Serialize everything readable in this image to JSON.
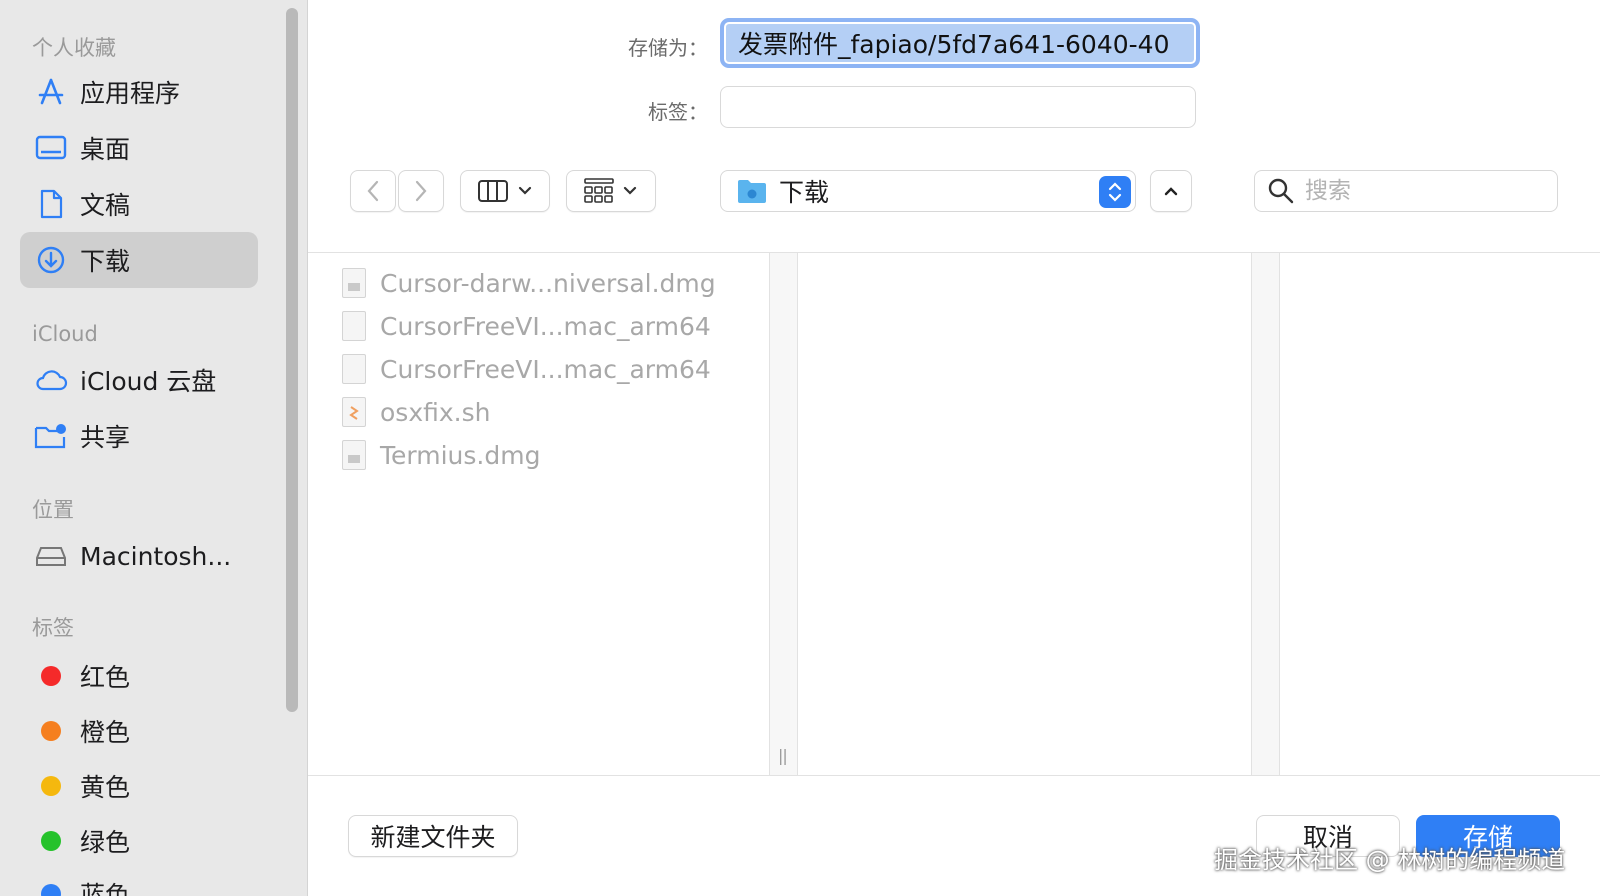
{
  "sidebar": {
    "sections": [
      {
        "title": "个人收藏"
      },
      {
        "title": "iCloud"
      },
      {
        "title": "位置"
      },
      {
        "title": "标签"
      }
    ],
    "favorites": [
      {
        "label": "应用程序",
        "icon": "applications-icon"
      },
      {
        "label": "桌面",
        "icon": "desktop-icon"
      },
      {
        "label": "文稿",
        "icon": "document-icon"
      },
      {
        "label": "下载",
        "icon": "downloads-icon",
        "selected": true
      }
    ],
    "icloud": [
      {
        "label": "iCloud 云盘",
        "icon": "icloud-icon"
      },
      {
        "label": "共享",
        "icon": "shared-folder-icon"
      }
    ],
    "locations": [
      {
        "label": "Macintosh...",
        "icon": "disk-icon"
      }
    ],
    "tags": [
      {
        "label": "红色",
        "color": "#f52a2a"
      },
      {
        "label": "橙色",
        "color": "#f57f1f"
      },
      {
        "label": "黄色",
        "color": "#f5b80e"
      },
      {
        "label": "绿色",
        "color": "#25c22b"
      },
      {
        "label": "蓝色",
        "color": "#2f7ff5"
      }
    ]
  },
  "form": {
    "save_as_label": "存储为：",
    "save_as_value": "发票附件_fapiao/5fd7a641-6040-40",
    "tags_label": "标签：",
    "tags_value": ""
  },
  "toolbar": {
    "location": "下载",
    "search_placeholder": "搜索"
  },
  "files": [
    {
      "name": "Cursor-darw...niversal.dmg",
      "icon": "dmg-file-icon"
    },
    {
      "name": "CursorFreeVI...mac_arm64",
      "icon": "blank-file-icon"
    },
    {
      "name": "CursorFreeVI...mac_arm64",
      "icon": "blank-file-icon"
    },
    {
      "name": "osxfix.sh",
      "icon": "script-file-icon"
    },
    {
      "name": "Termius.dmg",
      "icon": "dmg-file-icon"
    }
  ],
  "buttons": {
    "new_folder": "新建文件夹",
    "cancel": "取消",
    "save": "存储"
  },
  "watermark": "掘金技术社区 @ 林树的编程频道",
  "colors": {
    "accent": "#2f7ff5",
    "sidebar_bg": "#e8e8e8",
    "selection_bg": "#cfcfcf"
  }
}
